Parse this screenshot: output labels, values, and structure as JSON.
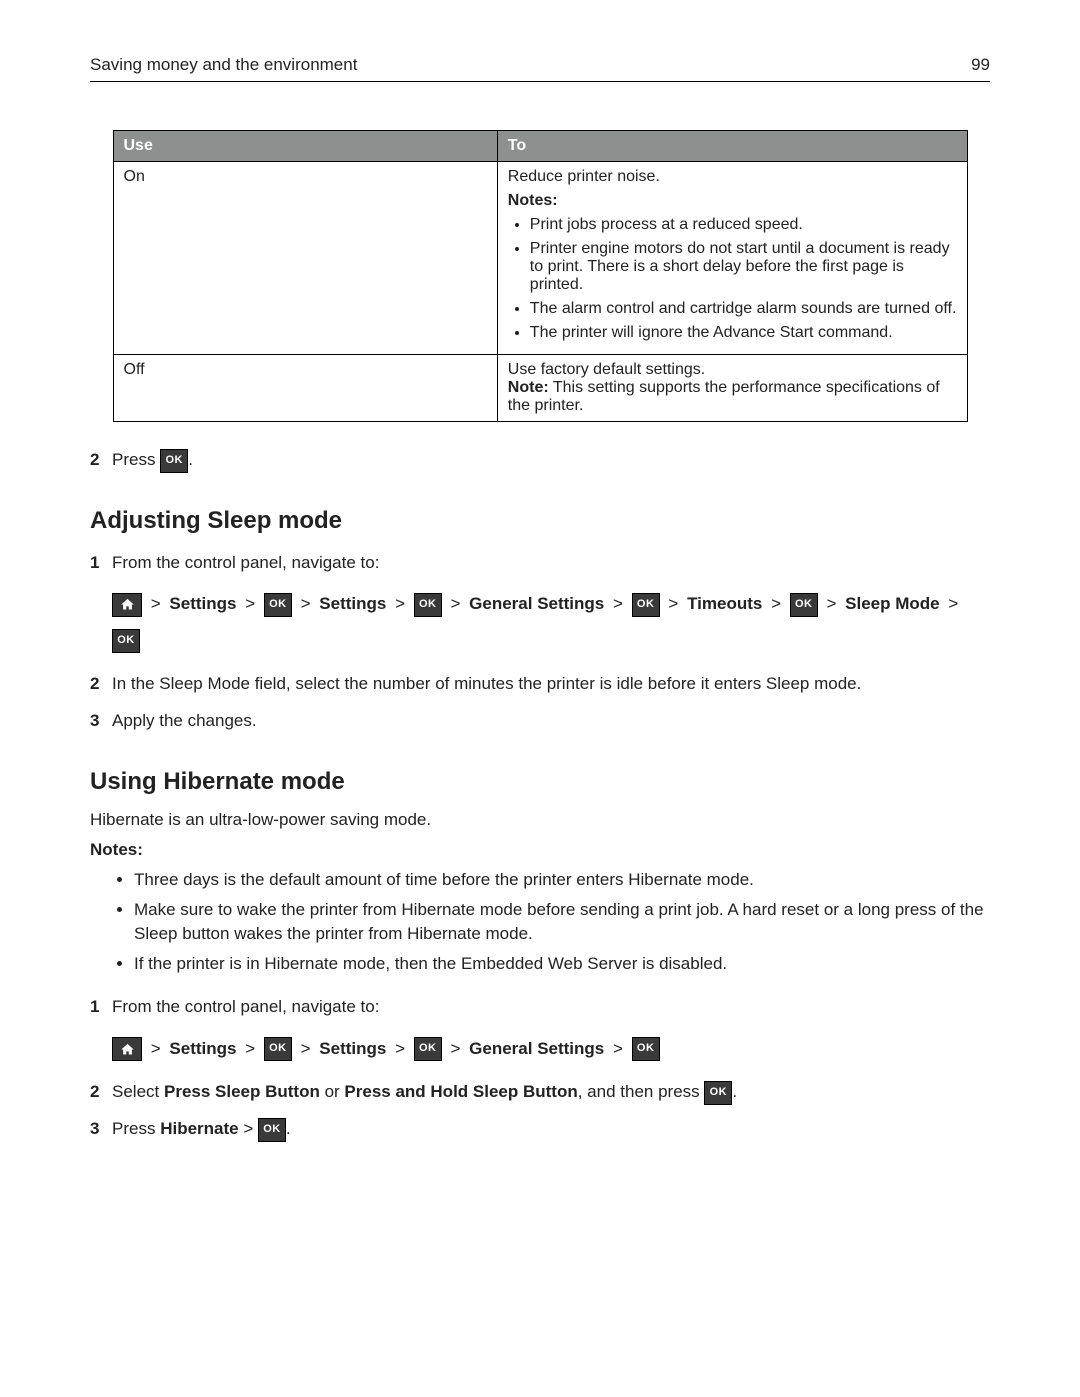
{
  "header": {
    "title": "Saving money and the environment",
    "page_number": "99"
  },
  "table": {
    "headers": {
      "use": "Use",
      "to": "To"
    },
    "rows": {
      "on": {
        "use": "On",
        "summary": "Reduce printer noise.",
        "notes_label": "Notes:",
        "notes": [
          "Print jobs process at a reduced speed.",
          "Printer engine motors do not start until a document is ready to print. There is a short delay before the first page is printed.",
          "The alarm control and cartridge alarm sounds are turned off.",
          "The printer will ignore the Advance Start command."
        ]
      },
      "off": {
        "use": "Off",
        "summary": "Use factory default settings.",
        "note_label": "Note:",
        "note_text": " This setting supports the performance specifications of the printer."
      }
    }
  },
  "step2_before": {
    "num": "2",
    "text_before": "Press ",
    "text_after": "."
  },
  "section_sleep": {
    "heading": "Adjusting Sleep mode",
    "steps": {
      "s1": {
        "num": "1",
        "text": "From the control panel, navigate to:"
      },
      "s2": {
        "num": "2",
        "text": "In the Sleep Mode field, select the number of minutes the printer is idle before it enters Sleep mode."
      },
      "s3": {
        "num": "3",
        "text": "Apply the changes."
      }
    },
    "nav": {
      "sep": ">",
      "settings1": "Settings",
      "settings2": "Settings",
      "general": "General Settings",
      "timeouts": "Timeouts",
      "sleep_mode": "Sleep Mode"
    }
  },
  "section_hibernate": {
    "heading": "Using Hibernate mode",
    "intro": "Hibernate is an ultra‑low‑power saving mode.",
    "notes_label": "Notes:",
    "notes": [
      "Three days is the default amount of time before the printer enters Hibernate mode.",
      "Make sure to wake the printer from Hibernate mode before sending a print job. A hard reset or a long press of the Sleep button wakes the printer from Hibernate mode.",
      "If the printer is in Hibernate mode, then the Embedded Web Server is disabled."
    ],
    "steps": {
      "s1": {
        "num": "1",
        "text": "From the control panel, navigate to:"
      },
      "s2": {
        "num": "2",
        "t_select": "Select ",
        "opt1": "Press Sleep Button",
        "t_or": " or ",
        "opt2": "Press and Hold Sleep Button",
        "t_then": ", and then press ",
        "t_after": "."
      },
      "s3": {
        "num": "3",
        "t_press": "Press ",
        "hibernate": "Hibernate",
        "sep": " > ",
        "t_after": "."
      }
    },
    "nav": {
      "sep": ">",
      "settings1": "Settings",
      "settings2": "Settings",
      "general": "General Settings"
    }
  },
  "icons": {
    "ok_label": "OK"
  }
}
